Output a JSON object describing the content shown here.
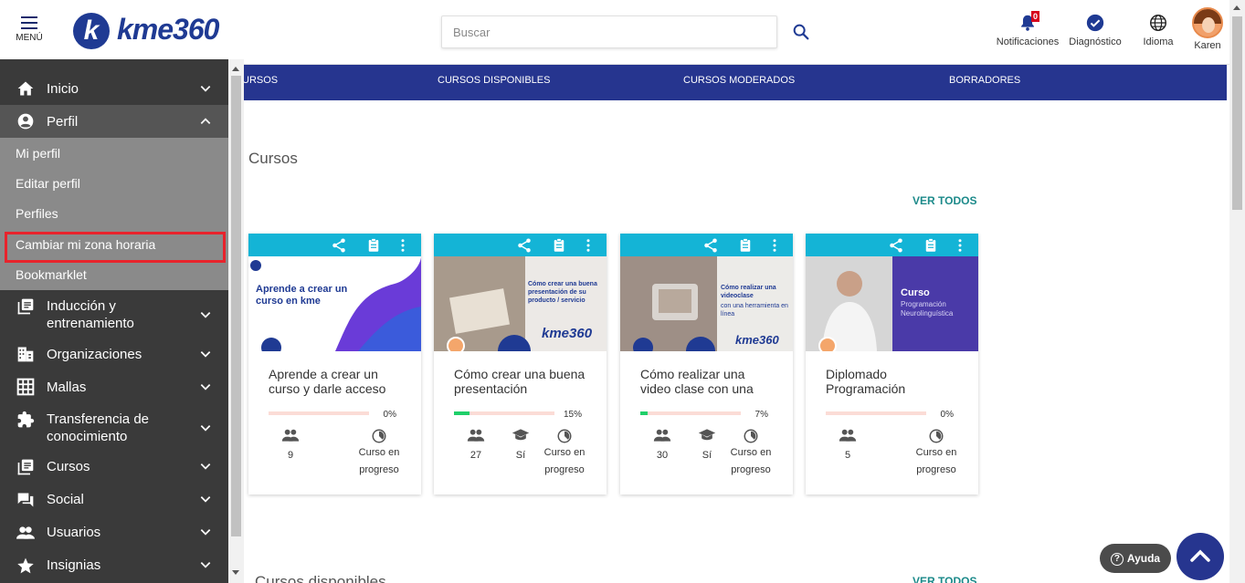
{
  "header": {
    "menu_label": "MENÚ",
    "logo_letter": "k",
    "logo_text": "kme360",
    "search_placeholder": "Buscar",
    "notifications_label": "Notificaciones",
    "notifications_count": "0",
    "diagnostic_label": "Diagnóstico",
    "language_label": "Idioma",
    "user_label": "Karen"
  },
  "nav": {
    "items": [
      "URSOS",
      "CURSOS DISPONIBLES",
      "CURSOS MODERADOS",
      "BORRADORES"
    ]
  },
  "sidebar": {
    "items": [
      {
        "label": "Inicio",
        "icon": "home-icon"
      },
      {
        "label": "Perfil",
        "icon": "account-circle-icon"
      },
      {
        "label": "Inducción y entrenamiento",
        "icon": "library-icon"
      },
      {
        "label": "Organizaciones",
        "icon": "building-icon"
      },
      {
        "label": "Mallas",
        "icon": "grid-icon"
      },
      {
        "label": "Transferencia de conocimiento",
        "icon": "puzzle-icon"
      },
      {
        "label": "Cursos",
        "icon": "library-icon"
      },
      {
        "label": "Social",
        "icon": "forum-icon"
      },
      {
        "label": "Usuarios",
        "icon": "people-icon"
      },
      {
        "label": "Insignias",
        "icon": "star-icon"
      }
    ],
    "perfil_submenu": [
      "Mi perfil",
      "Editar perfil",
      "Perfiles",
      "Cambiar mi zona horaria",
      "Bookmarklet"
    ]
  },
  "main": {
    "section_title": "Cursos",
    "ver_todos": "VER TODOS",
    "section2_title": "Cursos disponibles",
    "ver_todos2": "VER TODOS",
    "cards": [
      {
        "title": "Aprende a crear un curso y darle acceso",
        "progress_label": "0%",
        "progress": 0,
        "users": "9",
        "certificate": "",
        "status": "Curso en progreso",
        "thumb_text": "Aprende a crear un curso en kme"
      },
      {
        "title": "Cómo crear una buena presentación",
        "progress_label": "15%",
        "progress": 15,
        "users": "27",
        "certificate": "Sí",
        "status": "Curso en progreso",
        "thumb_text": "Cómo crear una buena presentación de su producto / servicio",
        "thumb_brand": "kme360"
      },
      {
        "title": "Cómo realizar una video clase con una",
        "progress_label": "7%",
        "progress": 7,
        "users": "30",
        "certificate": "Sí",
        "status": "Curso en progreso",
        "thumb_text": "Cómo realizar una videoclase",
        "thumb_sub": "con una herramienta en línea",
        "thumb_brand": "kme360"
      },
      {
        "title": "Diplomado Programación",
        "progress_label": "0%",
        "progress": 0,
        "users": "5",
        "certificate": "",
        "status": "Curso en progreso",
        "thumb_text": "Curso",
        "thumb_sub": "Programación Neurolinguística"
      }
    ]
  },
  "help": {
    "ayuda_label": "Ayuda"
  },
  "colors": {
    "brand_blue": "#26358f",
    "card_header": "#14b4d6",
    "progress_fill": "#1fcf6a",
    "highlight": "#e8232c"
  }
}
